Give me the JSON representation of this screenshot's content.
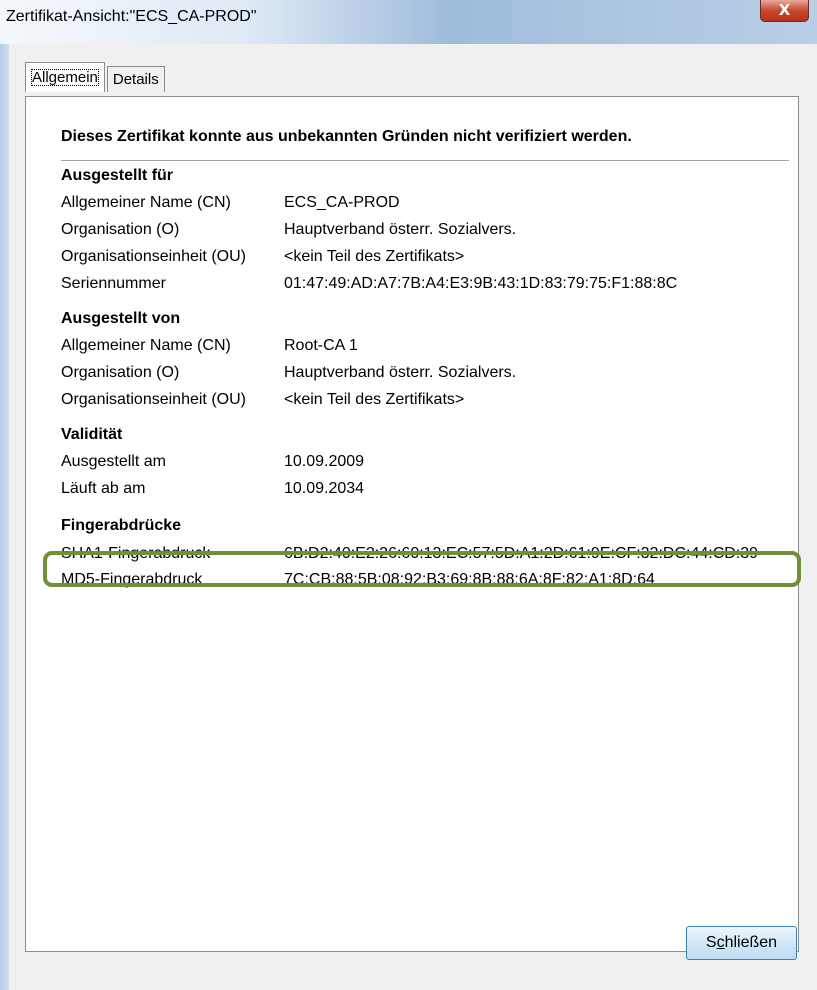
{
  "window": {
    "title": "Zertifikat-Ansicht:\"ECS_CA-PROD\"",
    "close_glyph": "X"
  },
  "tabs": [
    {
      "label": "Allgemein",
      "active": true
    },
    {
      "label": "Details",
      "active": false
    }
  ],
  "headline": "Dieses Zertifikat konnte aus unbekannten Gründen nicht verifiziert werden.",
  "sections": {
    "issued_to": {
      "heading": "Ausgestellt für",
      "rows": [
        {
          "key": "Allgemeiner Name (CN)",
          "value": "ECS_CA-PROD"
        },
        {
          "key": "Organisation (O)",
          "value": "Hauptverband österr. Sozialvers."
        },
        {
          "key": "Organisationseinheit (OU)",
          "value": "<kein Teil des Zertifikats>"
        },
        {
          "key": "Seriennummer",
          "value": "01:47:49:AD:A7:7B:A4:E3:9B:43:1D:83:79:75:F1:88:8C"
        }
      ]
    },
    "issued_by": {
      "heading": "Ausgestellt von",
      "rows": [
        {
          "key": "Allgemeiner Name (CN)",
          "value": "Root-CA 1"
        },
        {
          "key": "Organisation (O)",
          "value": "Hauptverband österr. Sozialvers."
        },
        {
          "key": "Organisationseinheit (OU)",
          "value": "<kein Teil des Zertifikats>"
        }
      ]
    },
    "validity": {
      "heading": "Validität",
      "rows": [
        {
          "key": "Ausgestellt am",
          "value": "10.09.2009"
        },
        {
          "key": "Läuft ab am",
          "value": "10.09.2034"
        }
      ]
    },
    "fingerprints": {
      "heading": "Fingerabdrücke",
      "rows": [
        {
          "key": "SHA1-Fingerabdruck",
          "value": "6B:D2:40:E2:26:60:13:EC:57:5D:A1:2D:61:9E:CF:32:DC:44:CD:39"
        },
        {
          "key": "MD5-Fingerabdruck",
          "value": "7C:CB:88:5B:08:92:B3:69:8B:88:6A:8F:82:A1:8D:64"
        }
      ]
    }
  },
  "footer": {
    "close_button_prefix": "S",
    "close_button_mnemonic": "c",
    "close_button_rest": "hließen"
  },
  "colors": {
    "highlight": "#6f9035",
    "close_red": "#c7492f"
  }
}
